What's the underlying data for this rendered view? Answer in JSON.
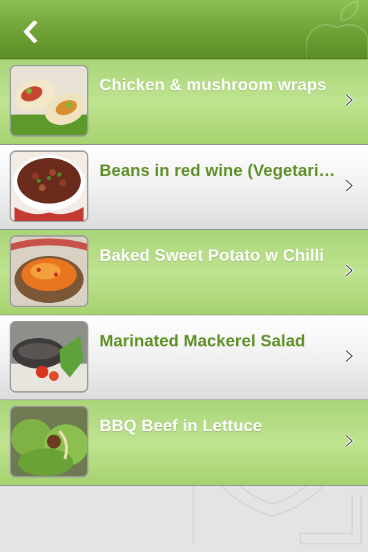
{
  "header": {
    "back_icon": "chevron-left-icon"
  },
  "recipes": [
    {
      "title": "Chicken & mushroom wraps",
      "style": "green",
      "thumb_icon": "wrap-photo"
    },
    {
      "title": "Beans in red wine (Vegetari…",
      "style": "white",
      "thumb_icon": "beans-photo"
    },
    {
      "title": "Baked Sweet Potato w Chilli",
      "style": "green",
      "thumb_icon": "sweet-potato-photo"
    },
    {
      "title": "Marinated Mackerel Salad",
      "style": "white",
      "thumb_icon": "mackerel-photo"
    },
    {
      "title": "BBQ Beef in Lettuce",
      "style": "green",
      "thumb_icon": "lettuce-beef-photo"
    }
  ],
  "colors": {
    "header_green": "#6fa136",
    "row_green": "#b5dd84",
    "title_green": "#5e8f25"
  }
}
